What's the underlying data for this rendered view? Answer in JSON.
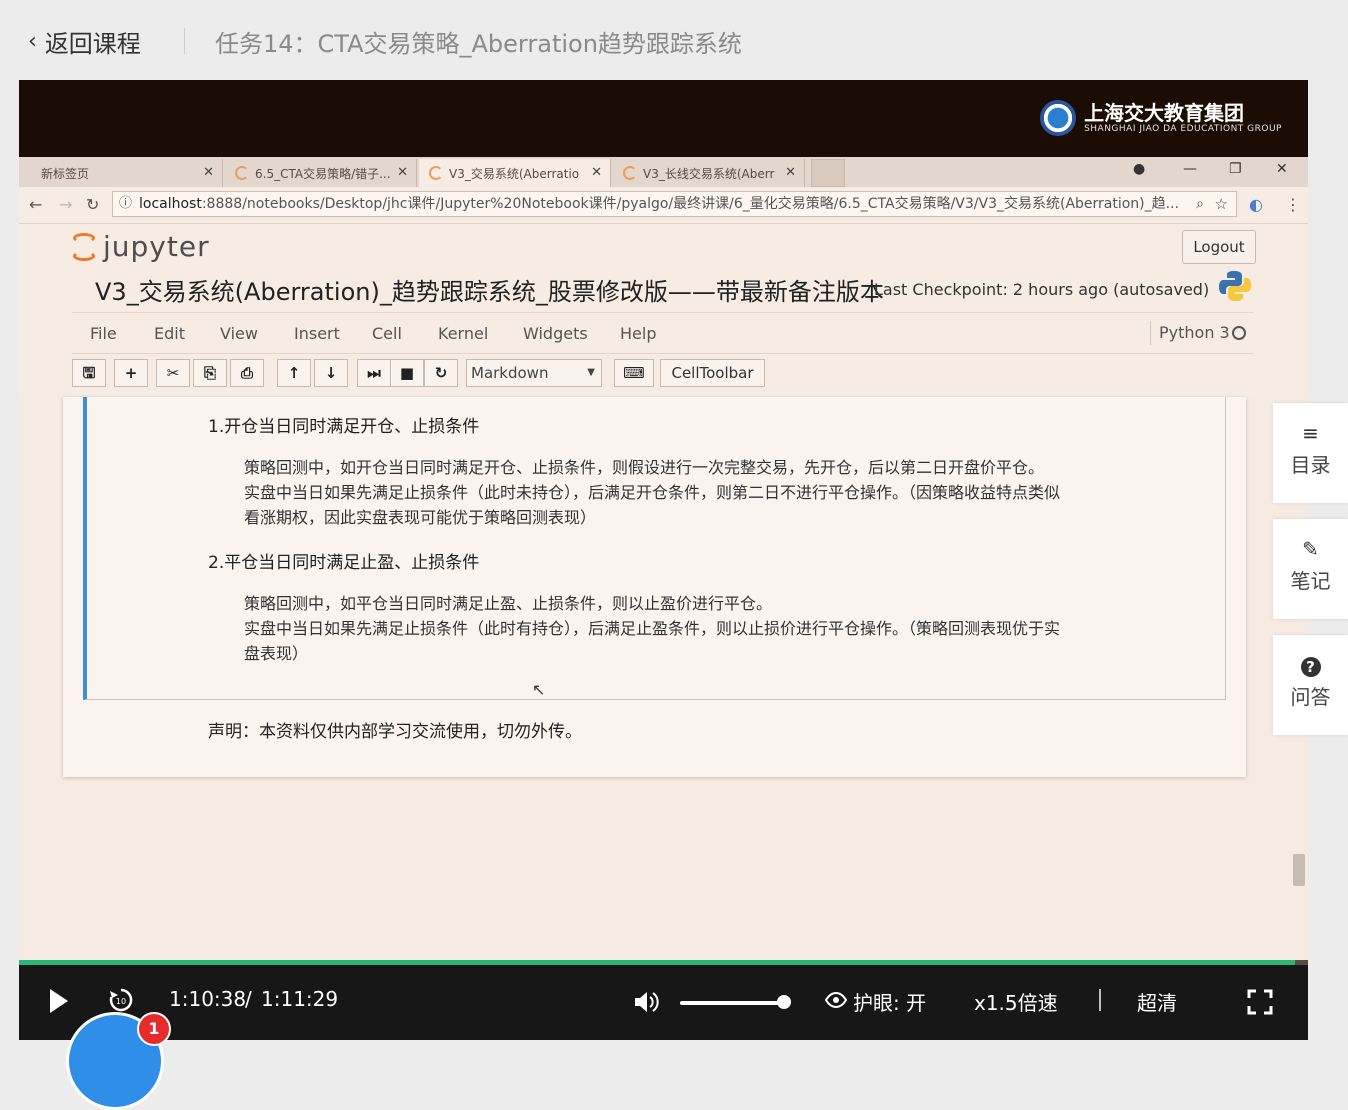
{
  "header": {
    "back_label": "返回课程",
    "course_title": "任务14：CTA交易策略_Aberration趋势跟踪系统"
  },
  "brand": {
    "name_cn": "上海交大教育集团",
    "name_en": "SHANGHAI JIAO DA EDUCATIONT GROUP"
  },
  "browser": {
    "tabs": [
      {
        "label": "新标签页"
      },
      {
        "label": "6.5_CTA交易策略/错子..."
      },
      {
        "label": "V3_交易系统(Aberratio"
      },
      {
        "label": "V3_长线交易系统(Aberr"
      }
    ],
    "url_host": "localhost",
    "url_rest": ":8888/notebooks/Desktop/jhc课件/Jupyter%20Notebook课件/pyalgo/最终讲课/6_量化交易策略/6.5_CTA交易策略/V3/V3_交易系统(Aberration)_趋..."
  },
  "notebook": {
    "logo_text": "jupyter",
    "logout_label": "Logout",
    "title": "V3_交易系统(Aberration)_趋势跟踪系统_股票修改版——带最新备注版本",
    "checkpoint": "Last Checkpoint: 2 hours ago (autosaved)",
    "menu": [
      "File",
      "Edit",
      "View",
      "Insert",
      "Cell",
      "Kernel",
      "Widgets",
      "Help"
    ],
    "kernel_label": "Python 3",
    "cell_type": "Markdown",
    "celltoolbar_label": "CellToolbar"
  },
  "cell": {
    "heading1": "1.开仓当日同时满足开仓、止损条件",
    "para1_line1": "策略回测中，如开仓当日同时满足开仓、止损条件，则假设进行一次完整交易，先开仓，后以第二日开盘价平仓。",
    "para1_line2": "实盘中当日如果先满足止损条件（此时未持仓），后满足开仓条件，则第二日不进行平仓操作。（因策略收益特点类似",
    "para1_line3": "看涨期权，因此实盘表现可能优于策略回测表现）",
    "heading2": "2.平仓当日同时满足止盈、止损条件",
    "para2_line1": "策略回测中，如平仓当日同时满足止盈、止损条件，则以止盈价进行平仓。",
    "para2_line2": "实盘中当日如果先满足止损条件（此时有持仓），后满足止盈条件，则以止损价进行平仓操作。（策略回测表现优于实",
    "para2_line3": "盘表现）",
    "notice": "声明：本资料仅供内部学习交流使用，切勿外传。"
  },
  "player": {
    "current_time": "1:10:38",
    "separator": "/",
    "total_time": "1:11:29",
    "eye_care": "护眼: 开",
    "speed": "x1.5倍速",
    "quality": "超清",
    "progress_percent": 99,
    "volume_percent": 100,
    "rewind_label": "10"
  },
  "side_panel": {
    "catalog": "目录",
    "notes": "笔记",
    "qa": "问答"
  },
  "notification_count": "1"
}
